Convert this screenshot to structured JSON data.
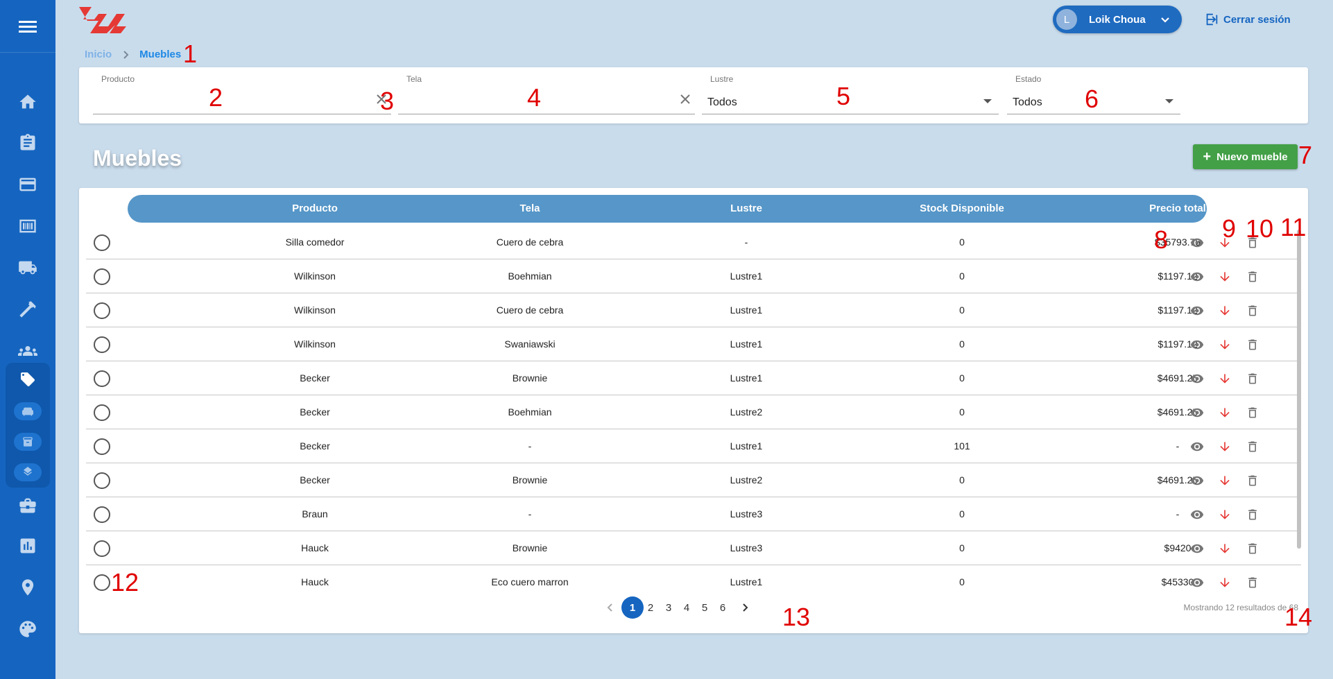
{
  "header": {
    "user": {
      "initial": "L",
      "name": "Loik Choua"
    },
    "logout_label": "Cerrar sesión"
  },
  "breadcrumb": {
    "home": "Inicio",
    "current": "Muebles"
  },
  "filters": {
    "producto": {
      "label": "Producto",
      "value": ""
    },
    "tela": {
      "label": "Tela",
      "value": ""
    },
    "lustre": {
      "label": "Lustre",
      "value": "Todos"
    },
    "estado": {
      "label": "Estado",
      "value": "Todos"
    }
  },
  "page_title": "Muebles",
  "new_button_label": "Nuevo mueble",
  "table": {
    "columns": [
      "Producto",
      "Tela",
      "Lustre",
      "Stock Disponible",
      "Precio total"
    ],
    "rows": [
      [
        "Silla comedor",
        "Cuero de cebra",
        "-",
        "0",
        "$35793.75"
      ],
      [
        "Wilkinson",
        "Boehmian",
        "Lustre1",
        "0",
        "$1197.12"
      ],
      [
        "Wilkinson",
        "Cuero de cebra",
        "Lustre1",
        "0",
        "$1197.12"
      ],
      [
        "Wilkinson",
        "Swaniawski",
        "Lustre1",
        "0",
        "$1197.12"
      ],
      [
        "Becker",
        "Brownie",
        "Lustre1",
        "0",
        "$4691.25"
      ],
      [
        "Becker",
        "Boehmian",
        "Lustre2",
        "0",
        "$4691.25"
      ],
      [
        "Becker",
        "-",
        "Lustre1",
        "101",
        "-"
      ],
      [
        "Becker",
        "Brownie",
        "Lustre2",
        "0",
        "$4691.25"
      ],
      [
        "Braun",
        "-",
        "Lustre3",
        "0",
        "-"
      ],
      [
        "Hauck",
        "Brownie",
        "Lustre3",
        "0",
        "$9420"
      ],
      [
        "Hauck",
        "Eco cuero marron",
        "Lustre1",
        "0",
        "$45330"
      ]
    ],
    "row_actions": [
      "eye-icon",
      "arrow-down-icon",
      "trash-icon"
    ]
  },
  "pagination": {
    "pages": [
      "1",
      "2",
      "3",
      "4",
      "5",
      "6"
    ],
    "current": "1",
    "results_text": "Mostrando 12 resultados de 68"
  },
  "annotations": [
    "1",
    "2",
    "3",
    "4",
    "5",
    "6",
    "7",
    "8",
    "9",
    "10",
    "11",
    "12",
    "13",
    "14"
  ],
  "colors": {
    "sidebar": "#1565c0",
    "background": "#c9dcec",
    "table_header": "#5696c8",
    "new_button": "#43a047",
    "annotation": "#e00000",
    "download_icon": "#e53935"
  },
  "sidebar_icons": [
    "home-icon",
    "clipboard-icon",
    "credit-card-icon",
    "barcode-icon",
    "truck-icon",
    "hammer-icon",
    "people-icon",
    "tag-icon",
    "sofa-icon",
    "box-icon",
    "layers-icon",
    "briefcase-icon",
    "chart-icon",
    "location-icon",
    "palette-icon"
  ]
}
